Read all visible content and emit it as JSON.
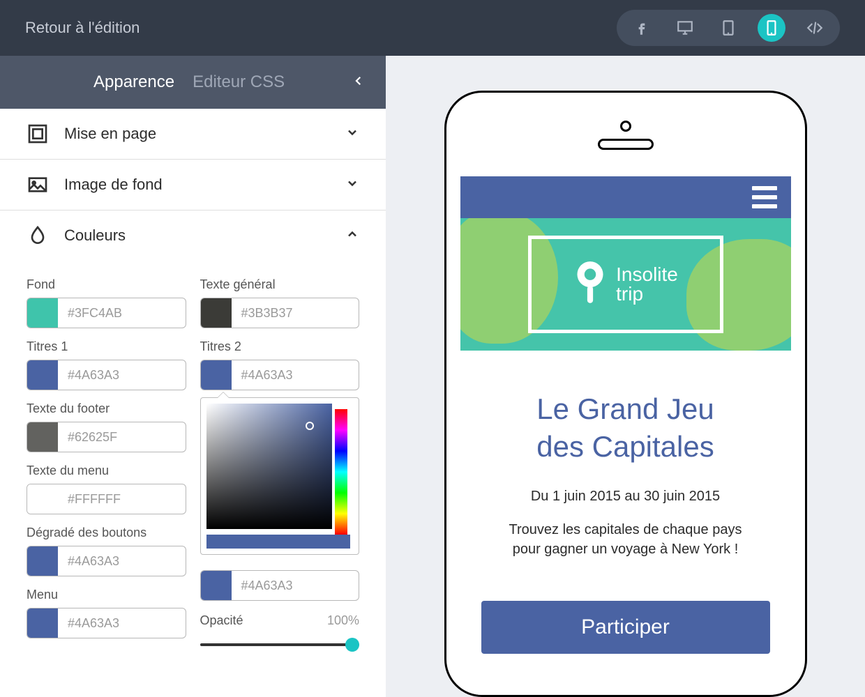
{
  "topbar": {
    "back": "Retour à l'édition"
  },
  "tabs": {
    "appearance": "Apparence",
    "css": "Editeur CSS"
  },
  "sections": {
    "layout": "Mise en page",
    "background": "Image de fond",
    "colors": "Couleurs"
  },
  "colors": {
    "fond": {
      "label": "Fond",
      "hex": "#3FC4AB",
      "swatch": "#3FC4AB"
    },
    "texte_general": {
      "label": "Texte général",
      "hex": "#3B3B37",
      "swatch": "#3B3B37"
    },
    "titres1": {
      "label": "Titres 1",
      "hex": "#4A63A3",
      "swatch": "#4A63A3"
    },
    "titres2": {
      "label": "Titres 2",
      "hex": "#4A63A3",
      "swatch": "#4A63A3"
    },
    "texte_footer": {
      "label": "Texte du footer",
      "hex": "#62625F",
      "swatch": "#62625F"
    },
    "texte_menu": {
      "label": "Texte du menu",
      "hex": "#FFFFFF",
      "swatch": "#FFFFFF"
    },
    "degrade_boutons": {
      "label": "Dégradé des boutons",
      "hex1": "#4A63A3",
      "sw1": "#4A63A3",
      "hex2": "#4A63A3",
      "sw2": "#4A63A3"
    },
    "menu": {
      "label": "Menu",
      "hex": "#4A63A3",
      "swatch": "#4A63A3"
    },
    "opacity": {
      "label": "Opacité",
      "value": "100%"
    }
  },
  "preview": {
    "logo1": "Insolite",
    "logo2": "trip",
    "title1": "Le Grand Jeu",
    "title2": "des Capitales",
    "dates": "Du 1 juin 2015 au 30 juin 2015",
    "desc1": "Trouvez les capitales de chaque pays",
    "desc2": "pour gagner un voyage à New York !",
    "cta": "Participer"
  }
}
